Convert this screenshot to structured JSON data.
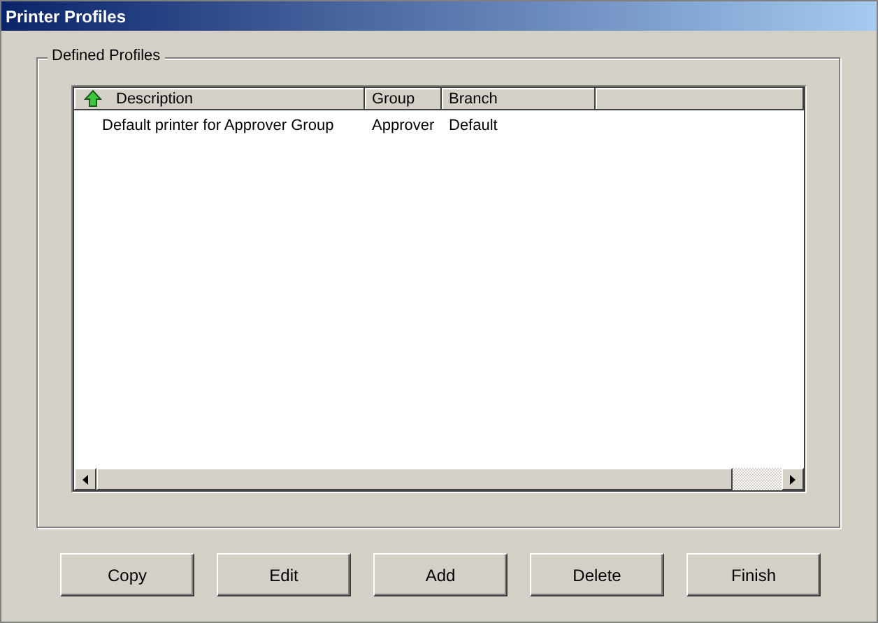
{
  "window": {
    "title": "Printer Profiles"
  },
  "group_box": {
    "label": "Defined Profiles"
  },
  "table": {
    "columns": [
      "Description",
      "Group",
      "Branch"
    ],
    "rows": [
      {
        "cells": [
          "Default printer for Approver Group",
          "Approver",
          "Default"
        ],
        "selected": false
      }
    ]
  },
  "buttons": [
    "Copy",
    "Edit",
    "Add",
    "Delete",
    "Finish"
  ]
}
